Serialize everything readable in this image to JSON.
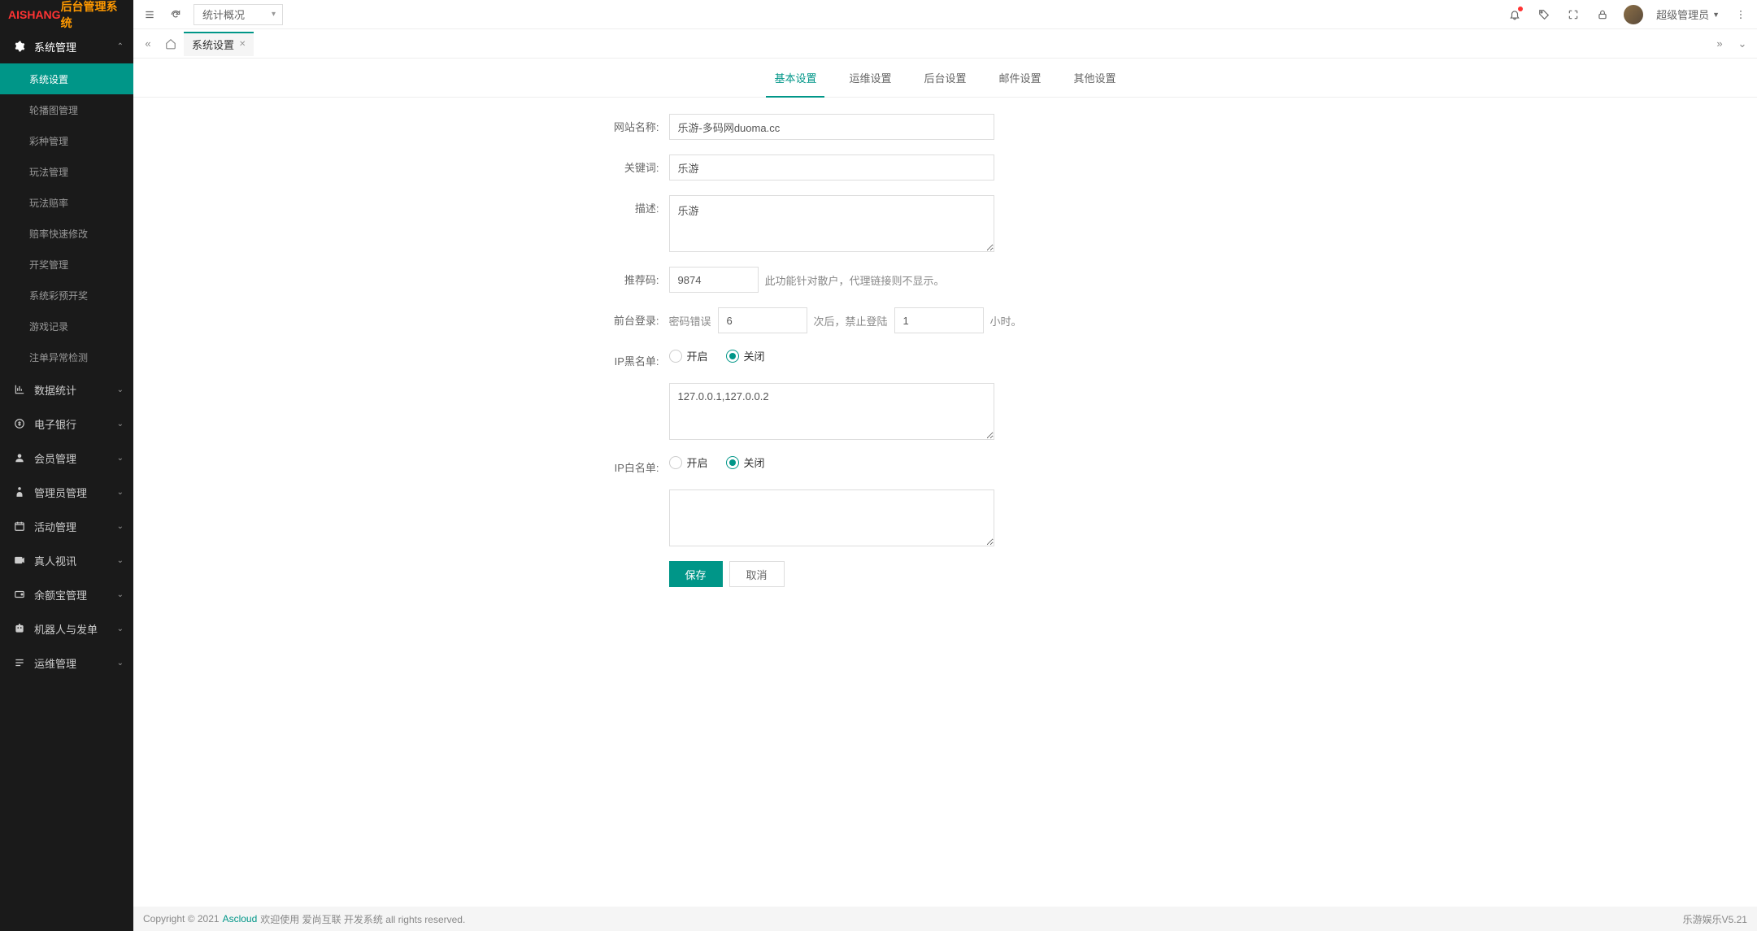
{
  "logo": {
    "brand_a": "AISHANG",
    "brand_b": "后台管理系统"
  },
  "topbar": {
    "dropdown": "统计概况",
    "user": "超级管理员"
  },
  "sidebar": {
    "groups": [
      {
        "label": "系统管理",
        "icon": "gear",
        "open": true,
        "items": [
          {
            "label": "系统设置",
            "active": true
          },
          {
            "label": "轮播图管理"
          },
          {
            "label": "彩种管理"
          },
          {
            "label": "玩法管理"
          },
          {
            "label": "玩法赔率"
          },
          {
            "label": "赔率快速修改"
          },
          {
            "label": "开奖管理"
          },
          {
            "label": "系统彩预开奖"
          },
          {
            "label": "游戏记录"
          },
          {
            "label": "注单异常检测"
          }
        ]
      },
      {
        "label": "数据统计",
        "icon": "chart"
      },
      {
        "label": "电子银行",
        "icon": "coin"
      },
      {
        "label": "会员管理",
        "icon": "user"
      },
      {
        "label": "管理员管理",
        "icon": "admin"
      },
      {
        "label": "活动管理",
        "icon": "calendar"
      },
      {
        "label": "真人视讯",
        "icon": "video"
      },
      {
        "label": "余额宝管理",
        "icon": "wallet"
      },
      {
        "label": "机器人与发单",
        "icon": "robot"
      },
      {
        "label": "运维管理",
        "icon": "ops"
      }
    ]
  },
  "tabs": {
    "current": "系统设置"
  },
  "content_tabs": {
    "t0": "基本设置",
    "t1": "运维设置",
    "t2": "后台设置",
    "t3": "邮件设置",
    "t4": "其他设置"
  },
  "form": {
    "site_name_label": "网站名称:",
    "site_name": "乐游-多码网duoma.cc",
    "keywords_label": "关键词:",
    "keywords": "乐游",
    "desc_label": "描述:",
    "desc": "乐游",
    "ref_code_label": "推荐码:",
    "ref_code": "9874",
    "ref_code_help": "此功能针对散户，代理链接则不显示。",
    "login_label": "前台登录:",
    "login_pre": "密码错误",
    "login_attempts": "6",
    "login_mid": "次后，禁止登陆",
    "login_hours": "1",
    "login_suf": "小时。",
    "ip_black_label": "IP黑名单:",
    "ip_white_label": "IP白名单:",
    "radio_on": "开启",
    "radio_off": "关闭",
    "ip_black_list": "127.0.0.1,127.0.0.2",
    "ip_white_list": "",
    "save": "保存",
    "cancel": "取消"
  },
  "footer": {
    "copyright_pre": "Copyright © 2021 ",
    "link": "Ascloud",
    "copyright_suf": " 欢迎使用 爱尚互联 开发系统 all rights reserved.",
    "version": "乐游娱乐V5.21"
  }
}
